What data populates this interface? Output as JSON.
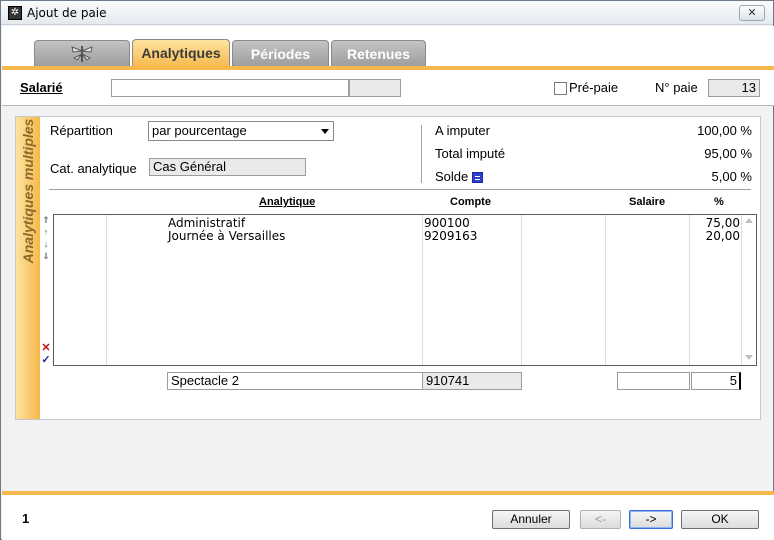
{
  "window": {
    "title": "Ajout de paie",
    "close_label": "✕"
  },
  "tabs": [
    {
      "label": "",
      "icon": "dragonfly-icon"
    },
    {
      "label": "Analytiques",
      "active": true
    },
    {
      "label": "Périodes"
    },
    {
      "label": "Retenues"
    }
  ],
  "salarie": {
    "label": "Salarié",
    "name_value": "",
    "code_value": "",
    "prepaie_label": "Pré-paie",
    "prepaie_checked": false,
    "npaie_label": "N° paie",
    "npaie_value": "13"
  },
  "analytiques": {
    "side_title": "Analytiques multiples",
    "repartition_label": "Répartition",
    "repartition_value": "par pourcentage",
    "cat_label": "Cat. analytique",
    "cat_value": "Cas Général",
    "a_imputer_label": "A imputer",
    "a_imputer_value": "100,00 %",
    "total_impute_label": "Total imputé",
    "total_impute_value": "95,00 %",
    "solde_label": "Solde",
    "solde_value": "5,00 %",
    "columns": {
      "analytique": "Analytique",
      "compte": "Compte",
      "salaire": "Salaire",
      "pct": "%"
    },
    "rows": [
      {
        "analytique": "Administratif",
        "compte": "900100",
        "salaire": "",
        "pct": "75,00"
      },
      {
        "analytique": "Journée à Versailles",
        "compte": "9209163",
        "salaire": "",
        "pct": "20,00"
      }
    ],
    "edit": {
      "analytique": "Spectacle 2",
      "compte": "910741",
      "salaire": "",
      "pct": "5"
    }
  },
  "footer": {
    "page_number": "1",
    "annuler_label": "Annuler",
    "prev_label": "<-",
    "next_label": "->",
    "ok_label": "OK"
  },
  "colors": {
    "accent": "#f7b84b",
    "tab_inactive": "#a8a8a8"
  }
}
